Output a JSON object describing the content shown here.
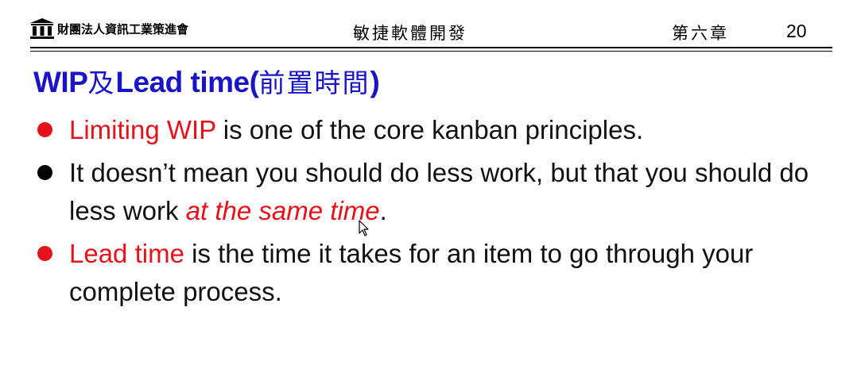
{
  "header": {
    "org_name": "財團法人資訊工業策進會",
    "course_title": "敏捷軟體開發",
    "chapter": "第六章",
    "page_number": "20"
  },
  "slide": {
    "title_en": "WIP",
    "title_conj": "及",
    "title_en2": "Lead time(",
    "title_cjk": "前置時間",
    "title_close": ")",
    "bullets": [
      {
        "dot_color": "#e6121b",
        "highlight": "Limiting WIP",
        "rest": " is one of the core kanban principles."
      },
      {
        "dot_color": "#000000",
        "text_before": "It doesn’t mean you should do less work, but that you should do less work ",
        "highlight": "at the same time",
        "text_after": "."
      },
      {
        "dot_color": "#e6121b",
        "highlight": "Lead time",
        "rest": " is the time it takes for an item to go through your complete process."
      }
    ]
  },
  "colors": {
    "title_blue": "#1a14c8",
    "highlight_red": "#e6121b"
  },
  "icons": {
    "logo": "temple-building-icon",
    "cursor": "mouse-pointer-icon"
  }
}
